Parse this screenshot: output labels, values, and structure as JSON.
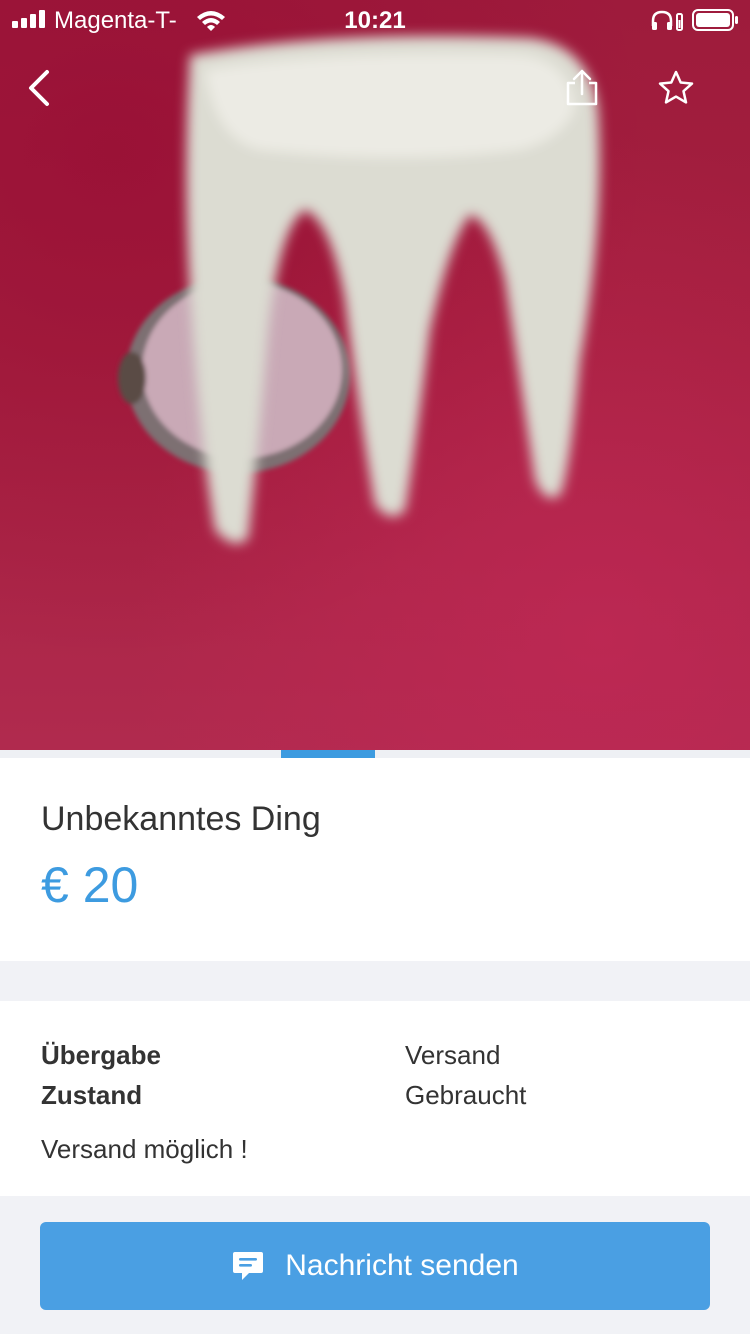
{
  "status_bar": {
    "carrier": "Magenta-T-",
    "time": "10:21"
  },
  "nav": {
    "back_icon": "chevron-left-icon",
    "share_icon": "share-icon",
    "favorite_icon": "star-outline-icon"
  },
  "gallery": {
    "image_subject": "blurred white tooth-shaped object on red cloth"
  },
  "listing": {
    "title": "Unbekanntes Ding",
    "price": "€ 20"
  },
  "details": {
    "rows": [
      {
        "label": "Übergabe",
        "value": "Versand"
      },
      {
        "label": "Zustand",
        "value": "Gebraucht"
      }
    ],
    "note": "Versand möglich !"
  },
  "action": {
    "button_label": "Nachricht senden",
    "button_icon": "chat-bubble-icon"
  },
  "colors": {
    "accent": "#3d9be0",
    "button": "#4a9fe3",
    "photo_background": "#a5203f"
  }
}
